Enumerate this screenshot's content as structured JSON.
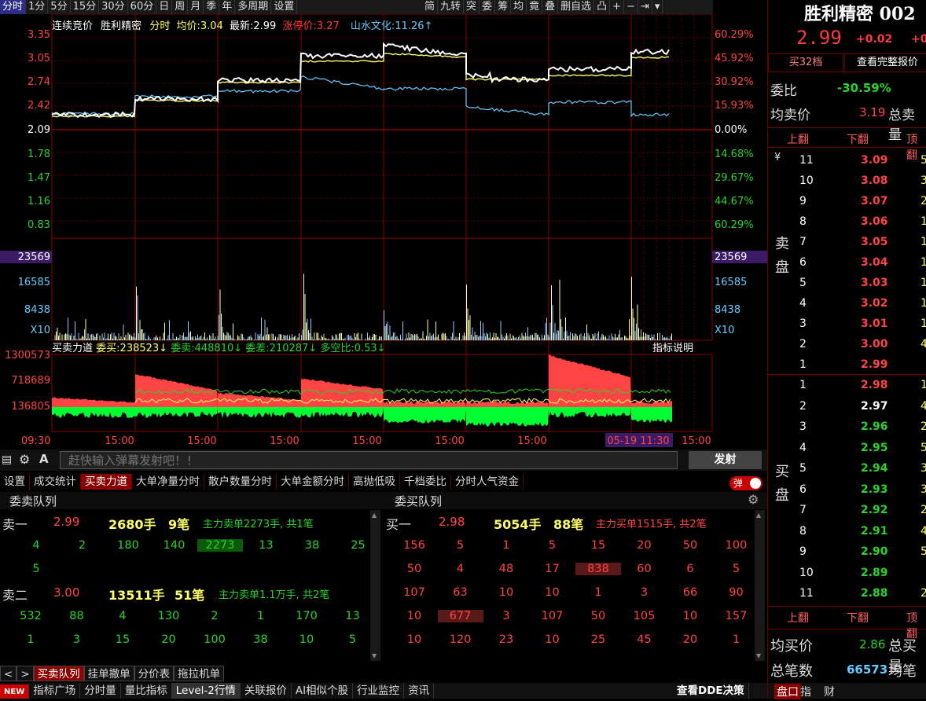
{
  "period_tabs": [
    "分时",
    "1分",
    "5分",
    "15分",
    "30分",
    "60分",
    "日",
    "周",
    "月",
    "季",
    "年",
    "多周期",
    "设置"
  ],
  "tools": [
    "简",
    "九转",
    "突",
    "委",
    "筹",
    "均",
    "竟",
    "叠",
    "删自选",
    "凸",
    "+",
    "−",
    "⇥",
    "▾"
  ],
  "info": {
    "mode": "连续竞价",
    "name": "胜利精密",
    "label": "分时",
    "avg_label": "均价:",
    "avg": "3.04",
    "last_label": "最新:",
    "last": "2.99",
    "limit_label": "涨停价:",
    "limit": "3.27",
    "compare": "山水文化:",
    "compare_val": "11.26↑"
  },
  "price_axis_left": [
    "3.35",
    "3.05",
    "2.74",
    "2.42",
    "2.09",
    "1.78",
    "1.47",
    "1.16",
    "0.83"
  ],
  "price_axis_right": [
    "60.29%",
    "45.92%",
    "30.92%",
    "15.93%",
    "0.00%",
    "14.68%",
    "29.67%",
    "44.67%",
    "60.29%"
  ],
  "vol_axis": [
    "23569",
    "16585",
    "8438",
    "X10"
  ],
  "force": {
    "title": "买卖力道",
    "buy_label": "委买:",
    "buy": "238523↓",
    "sell_label": "委卖:",
    "sell": "448810↓",
    "diff_label": "委差:",
    "diff": "210287↓",
    "ratio_label": "多空比:",
    "ratio": "0.53↓",
    "explain": "指标说明"
  },
  "force_axis": [
    "1300573",
    "718689",
    "136805"
  ],
  "time_axis": [
    "09:30",
    "15:00",
    "15:00",
    "15:00",
    "15:00",
    "15:00",
    "15:00",
    "05-19 11:30",
    "15:00"
  ],
  "danmu": {
    "placeholder": "赶快输入弹幕发射吧！！",
    "send": "发射"
  },
  "sub_tabs": [
    "设置",
    "成交统计",
    "买卖力道",
    "大单净量分时",
    "散户数量分时",
    "大单金额分时",
    "高抛低吸",
    "千档委比",
    "分时人气资金"
  ],
  "danmu_toggle": "弹",
  "queue": {
    "sell_title": "委卖队列",
    "buy_title": "委买队列",
    "sell1": {
      "label": "卖一",
      "price": "2.99",
      "vol": "2680手",
      "cnt": "9笔",
      "note": "主力卖单2273手, 共1笔"
    },
    "sell1_cells": [
      "4",
      "2",
      "180",
      "140",
      "2273",
      "13",
      "38",
      "25",
      "5"
    ],
    "sell2": {
      "label": "卖二",
      "price": "3.00",
      "vol": "13511手",
      "cnt": "51笔",
      "note": "主力卖单1.1万手, 共2笔"
    },
    "sell2_cells": [
      "532",
      "88",
      "4",
      "130",
      "2",
      "1",
      "170",
      "13",
      "1",
      "3",
      "15",
      "20",
      "100",
      "38",
      "10",
      "5"
    ],
    "buy1": {
      "label": "买一",
      "price": "2.98",
      "vol": "5054手",
      "cnt": "88笔",
      "note": "主力买单1515手, 共2笔"
    },
    "buy1_cells": [
      "156",
      "5",
      "1",
      "5",
      "15",
      "20",
      "50",
      "100",
      "50",
      "4",
      "48",
      "17",
      "838",
      "60",
      "6",
      "5",
      "107",
      "63",
      "10",
      "10",
      "1",
      "3",
      "66",
      "90",
      "10",
      "677",
      "3",
      "107",
      "50",
      "105",
      "10",
      "157",
      "10",
      "120",
      "23",
      "10",
      "25",
      "45",
      "20",
      "1"
    ]
  },
  "lower_tabs": [
    "<",
    ">",
    "买卖队列",
    "挂单撤单",
    "分价表",
    "拖拉机单"
  ],
  "status_tabs": [
    "NEW",
    "指标广场",
    "分时量",
    "量比指标",
    "Level-2行情",
    "关联报价",
    "AI相似个股",
    "行业监控",
    "资讯",
    "查看DDE决策"
  ],
  "right": {
    "title": "胜利精密 002",
    "price": "2.99",
    "chg": "+0.02",
    "chg2": "+0.6",
    "btn1": "买32档",
    "btn2": "查看完整报价",
    "weibi_label": "委比",
    "weibi": "-30.59%",
    "avg_sell_label": "均卖价",
    "avg_sell": "3.19",
    "total_sell_label": "总卖量",
    "nav": [
      "上翻",
      "下翻",
      "顶翻"
    ],
    "currency": "¥",
    "sell_side": "卖盘",
    "buy_side": "买盘",
    "sells": [
      [
        "11",
        "3.09",
        "5"
      ],
      [
        "10",
        "3.08",
        "3"
      ],
      [
        "9",
        "3.07",
        "2"
      ],
      [
        "8",
        "3.06",
        "1"
      ],
      [
        "7",
        "3.05",
        "1"
      ],
      [
        "6",
        "3.04",
        "1"
      ],
      [
        "5",
        "3.03",
        "1"
      ],
      [
        "4",
        "3.02",
        "1"
      ],
      [
        "3",
        "3.01",
        "1"
      ],
      [
        "2",
        "3.00",
        "4"
      ],
      [
        "1",
        "2.99",
        ""
      ]
    ],
    "buys": [
      [
        "1",
        "2.98",
        "1"
      ],
      [
        "2",
        "2.97",
        "4"
      ],
      [
        "3",
        "2.96",
        "2"
      ],
      [
        "4",
        "2.95",
        "5"
      ],
      [
        "5",
        "2.94",
        "3"
      ],
      [
        "6",
        "2.93",
        "3"
      ],
      [
        "7",
        "2.92",
        "2"
      ],
      [
        "8",
        "2.91",
        "4"
      ],
      [
        "9",
        "2.90",
        "5"
      ],
      [
        "10",
        "2.89",
        ""
      ],
      [
        "11",
        "2.88",
        "2"
      ]
    ],
    "nav2": [
      "上翻",
      "下翻",
      "顶翻"
    ],
    "avg_buy_label": "均买价",
    "avg_buy": "2.86",
    "total_buy_label": "总买量",
    "trades_label": "总笔数",
    "trades": "66573",
    "avg_trade_label": "均笔量",
    "bottom_tabs": [
      "盘口",
      "指",
      "财"
    ]
  },
  "colors": {
    "up": "#ff3b3b",
    "down": "#2ad22a",
    "yellow": "#ffff66",
    "cyan": "#6cf"
  }
}
